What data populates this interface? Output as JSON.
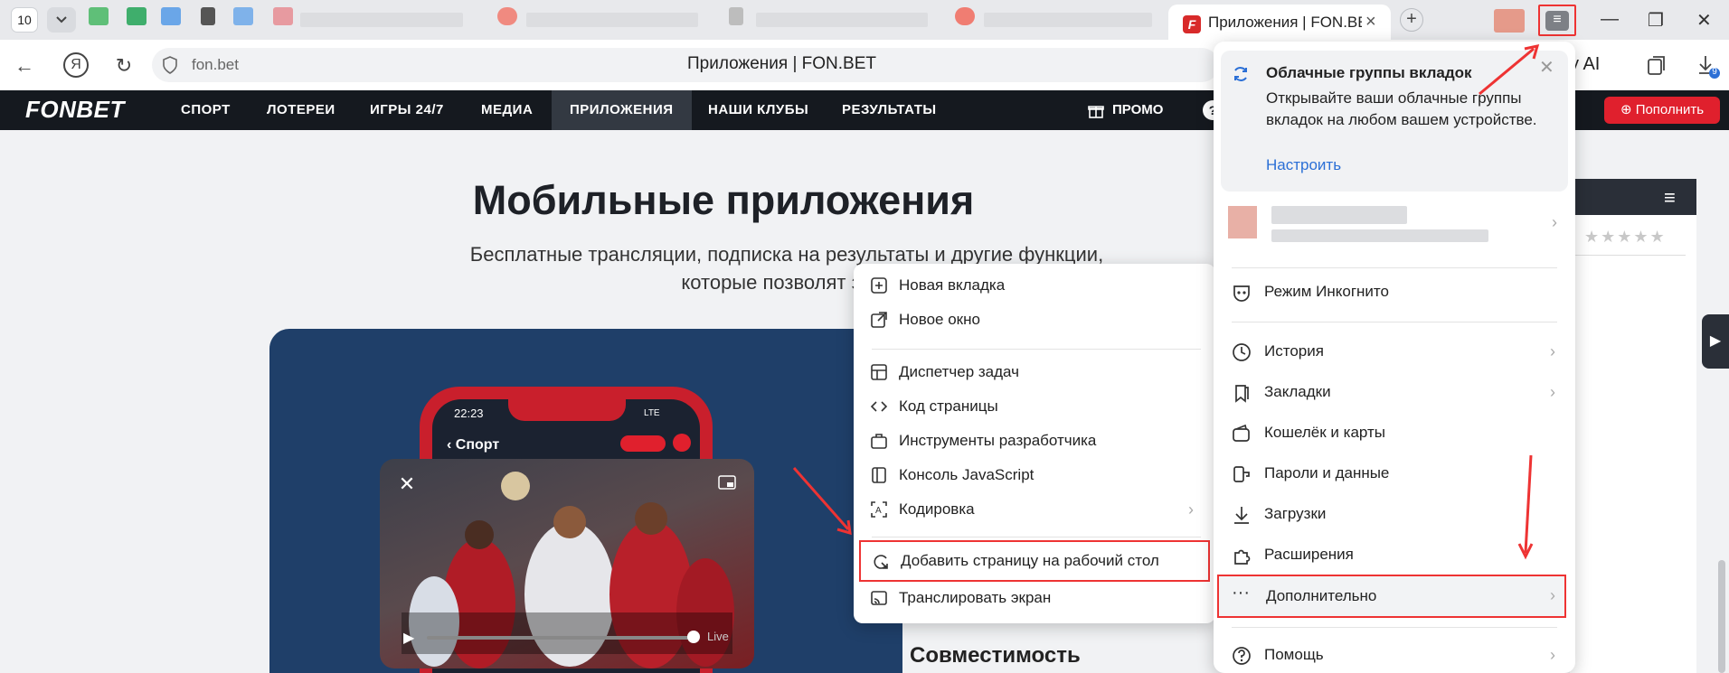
{
  "browser": {
    "tab_count": "10",
    "active_tab_title": "Приложения | FON.BET",
    "active_tab_favicon": "F",
    "url_domain": "fon.bet",
    "page_title": "Приложения | FON.BET",
    "ai_label": "y AI",
    "downloads_badge": "9"
  },
  "site": {
    "logo": "FONBET",
    "nav": [
      "СПОРТ",
      "ЛОТЕРЕИ",
      "ИГРЫ 24/7",
      "МЕДИА",
      "ПРИЛОЖЕНИЯ",
      "НАШИ КЛУБЫ",
      "РЕЗУЛЬТАТЫ"
    ],
    "promo": "ПРОМО",
    "deposit": "Пополнить",
    "heading": "Мобильные приложения",
    "subtitle_1": "Бесплатные трансляции, подписка на результаты и другие функции,",
    "subtitle_2": "которые позволят закл",
    "phone_time": "22:23",
    "phone_status": "LTE",
    "phone_title": "Спорт",
    "video_live": "Live",
    "compat": "Совместимость"
  },
  "context_menu": {
    "items": [
      {
        "label": "Новая вкладка",
        "icon": "new-tab-icon"
      },
      {
        "label": "Новое окно",
        "icon": "new-window-icon"
      },
      {
        "label": "Диспетчер задач",
        "icon": "task-manager-icon"
      },
      {
        "label": "Код страницы",
        "icon": "code-icon"
      },
      {
        "label": "Инструменты разработчика",
        "icon": "devtools-icon"
      },
      {
        "label": "Консоль JavaScript",
        "icon": "console-icon"
      },
      {
        "label": "Кодировка",
        "icon": "encoding-icon"
      },
      {
        "label": "Добавить страницу на рабочий стол",
        "icon": "add-to-desktop-icon"
      },
      {
        "label": "Транслировать экран",
        "icon": "cast-icon"
      }
    ]
  },
  "main_menu": {
    "cloud_title": "Облачные группы вкладок",
    "cloud_text": "Открывайте ваши облачные группы вкладок на любом вашем устройстве.",
    "cloud_link": "Настроить",
    "items": [
      {
        "label": "Режим Инкогнито",
        "icon": "incognito-icon"
      },
      {
        "label": "История",
        "icon": "history-icon"
      },
      {
        "label": "Закладки",
        "icon": "bookmarks-icon"
      },
      {
        "label": "Кошелёк и карты",
        "icon": "wallet-icon"
      },
      {
        "label": "Пароли и данные",
        "icon": "key-icon"
      },
      {
        "label": "Загрузки",
        "icon": "download-icon"
      },
      {
        "label": "Расширения",
        "icon": "extensions-icon"
      },
      {
        "label": "Дополнительно",
        "icon": "more-icon"
      },
      {
        "label": "Помощь",
        "icon": "help-icon"
      }
    ]
  },
  "colors": {
    "highlight": "#ee3333",
    "site_nav": "#15191f",
    "deposit": "#e0202d",
    "link": "#2b6fd6"
  }
}
